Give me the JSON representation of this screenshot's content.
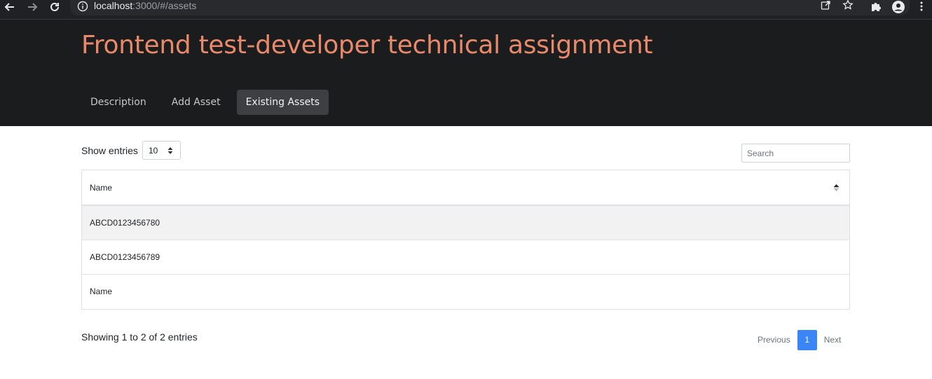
{
  "browser": {
    "url_host": "localhost",
    "url_rest": ":3000/#/assets"
  },
  "header": {
    "title": "Frontend test-developer technical assignment",
    "tabs": [
      {
        "label": "Description",
        "active": false
      },
      {
        "label": "Add Asset",
        "active": false
      },
      {
        "label": "Existing Assets",
        "active": true
      }
    ]
  },
  "controls": {
    "show_label": "Show entries",
    "page_size": "10",
    "search_placeholder": "Search"
  },
  "table": {
    "header": "Name",
    "rows": [
      "ABCD0123456780",
      "ABCD0123456789"
    ],
    "footer": "Name"
  },
  "pagination": {
    "info": "Showing 1 to 2 of 2 entries",
    "previous": "Previous",
    "current_page": "1",
    "next": "Next"
  },
  "colors": {
    "title": "#e8896a",
    "header_bg": "#1b1c1e",
    "active_tab_bg": "#3d3f42",
    "page_active": "#3b86f7"
  }
}
